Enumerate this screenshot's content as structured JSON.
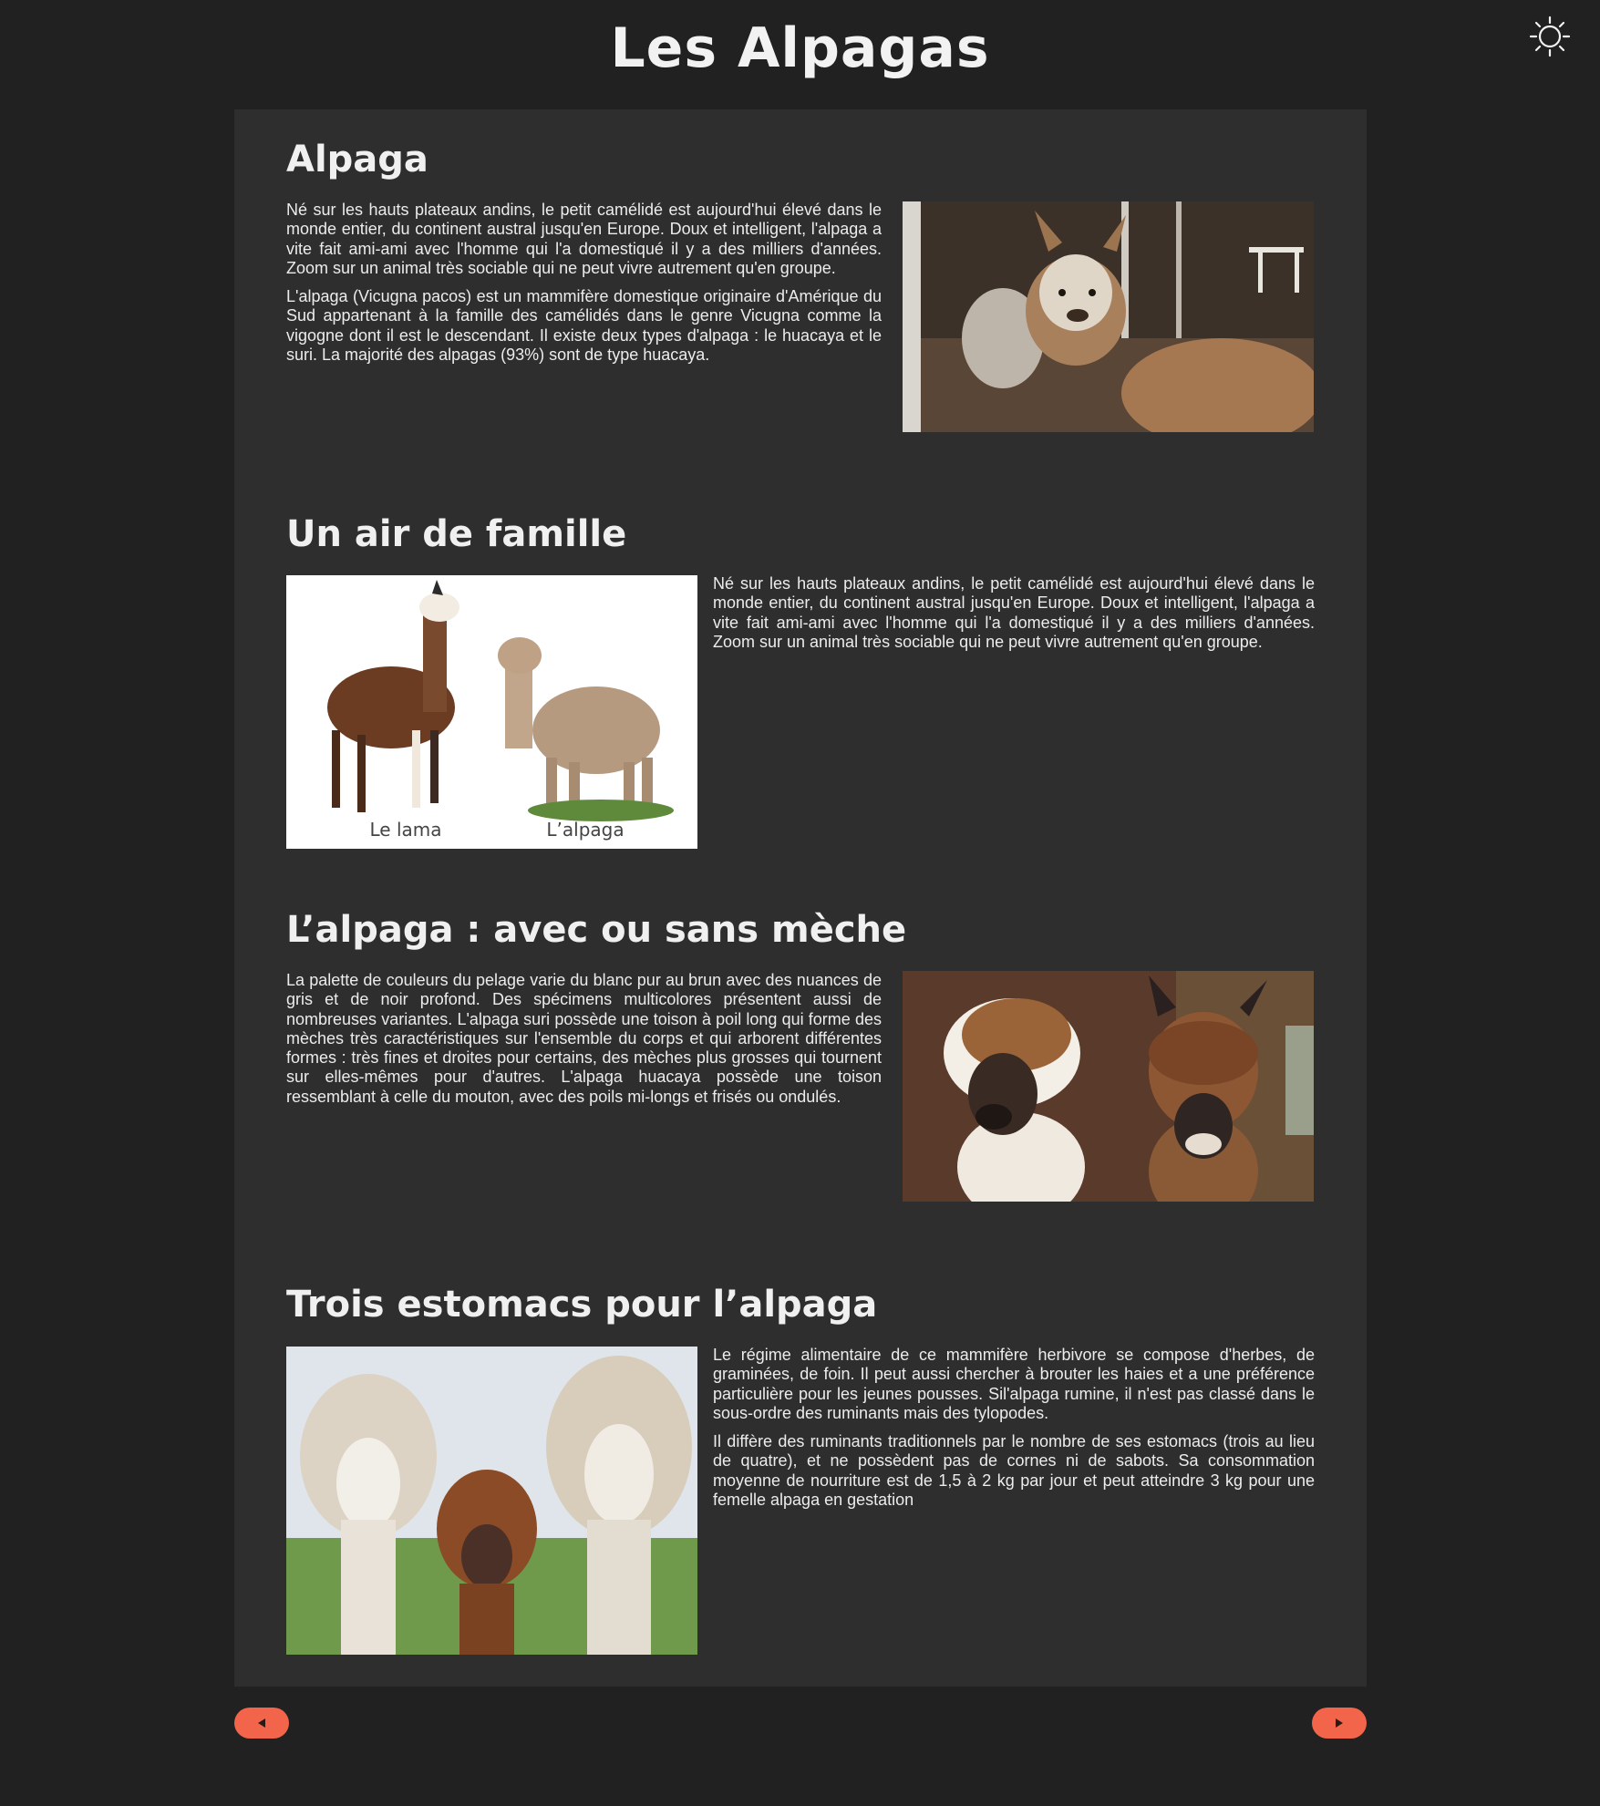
{
  "page": {
    "title": "Les Alpagas"
  },
  "theme_toggle": {
    "icon": "sun-icon"
  },
  "sections": [
    {
      "title": "Alpaga",
      "paragraphs": [
        "Né sur les hauts plateaux andins, le petit camélidé est aujourd'hui élevé dans le monde entier, du continent austral jusqu'en Europe. Doux et intelligent, l'alpaga a vite fait ami-ami avec l'homme qui l'a domestiqué il y a des milliers d'années. Zoom sur un animal très sociable qui ne peut vivre autrement qu'en groupe.",
        "L'alpaga (Vicugna pacos) est un mammifère domestique originaire d'Amérique du Sud appartenant à la famille des camélidés dans le genre Vicugna comme la vigogne dont il est le descendant. Il existe deux types d'alpaga : le huacaya et le suri. La majorité des alpagas (93%) sont de type huacaya."
      ]
    },
    {
      "title": "Un air de famille",
      "paragraphs": [
        "Né sur les hauts plateaux andins, le petit camélidé est aujourd'hui élevé dans le monde entier, du continent austral jusqu'en Europe. Doux et intelligent, l'alpaga a vite fait ami-ami avec l'homme qui l'a domestiqué il y a des milliers d'années. Zoom sur un animal très sociable qui ne peut vivre autrement qu'en groupe."
      ],
      "image_captions": [
        "Le lama",
        "L’alpaga"
      ]
    },
    {
      "title": "L’alpaga : avec ou sans mèche",
      "paragraphs": [
        "La palette de couleurs du pelage varie du blanc pur au brun avec des nuances de gris et de noir profond. Des spécimens multicolores présentent aussi de nombreuses variantes. L'alpaga suri possède une toison à poil long qui forme des mèches très caractéristiques sur l'ensemble du corps et qui arborent différentes formes : très fines et droites pour certains, des mèches plus grosses qui tournent sur elles-mêmes pour d'autres. L'alpaga huacaya possède une toison ressemblant à celle du mouton, avec des poils mi-longs et frisés ou ondulés."
      ]
    },
    {
      "title": "Trois estomacs pour l’alpaga",
      "paragraphs": [
        "Le régime alimentaire de ce mammifère herbivore se compose d'herbes, de graminées, de foin. Il peut aussi chercher à brouter les haies et a une préférence particulière pour les jeunes pousses. Sil'alpaga rumine, il n'est pas classé dans le sous-ordre des ruminants mais des tylopodes.",
        "Il diffère des ruminants traditionnels par le nombre de ses estomacs (trois au lieu de quatre), et ne possèdent pas de cornes ni de sabots. Sa consommation moyenne de nourriture est de 1,5 à 2 kg par jour et peut atteindre 3 kg pour une femelle alpaga en gestation"
      ]
    }
  ],
  "nav": {
    "prev_icon": "triangle-left-icon",
    "next_icon": "triangle-right-icon",
    "accent": "#f2654a"
  }
}
